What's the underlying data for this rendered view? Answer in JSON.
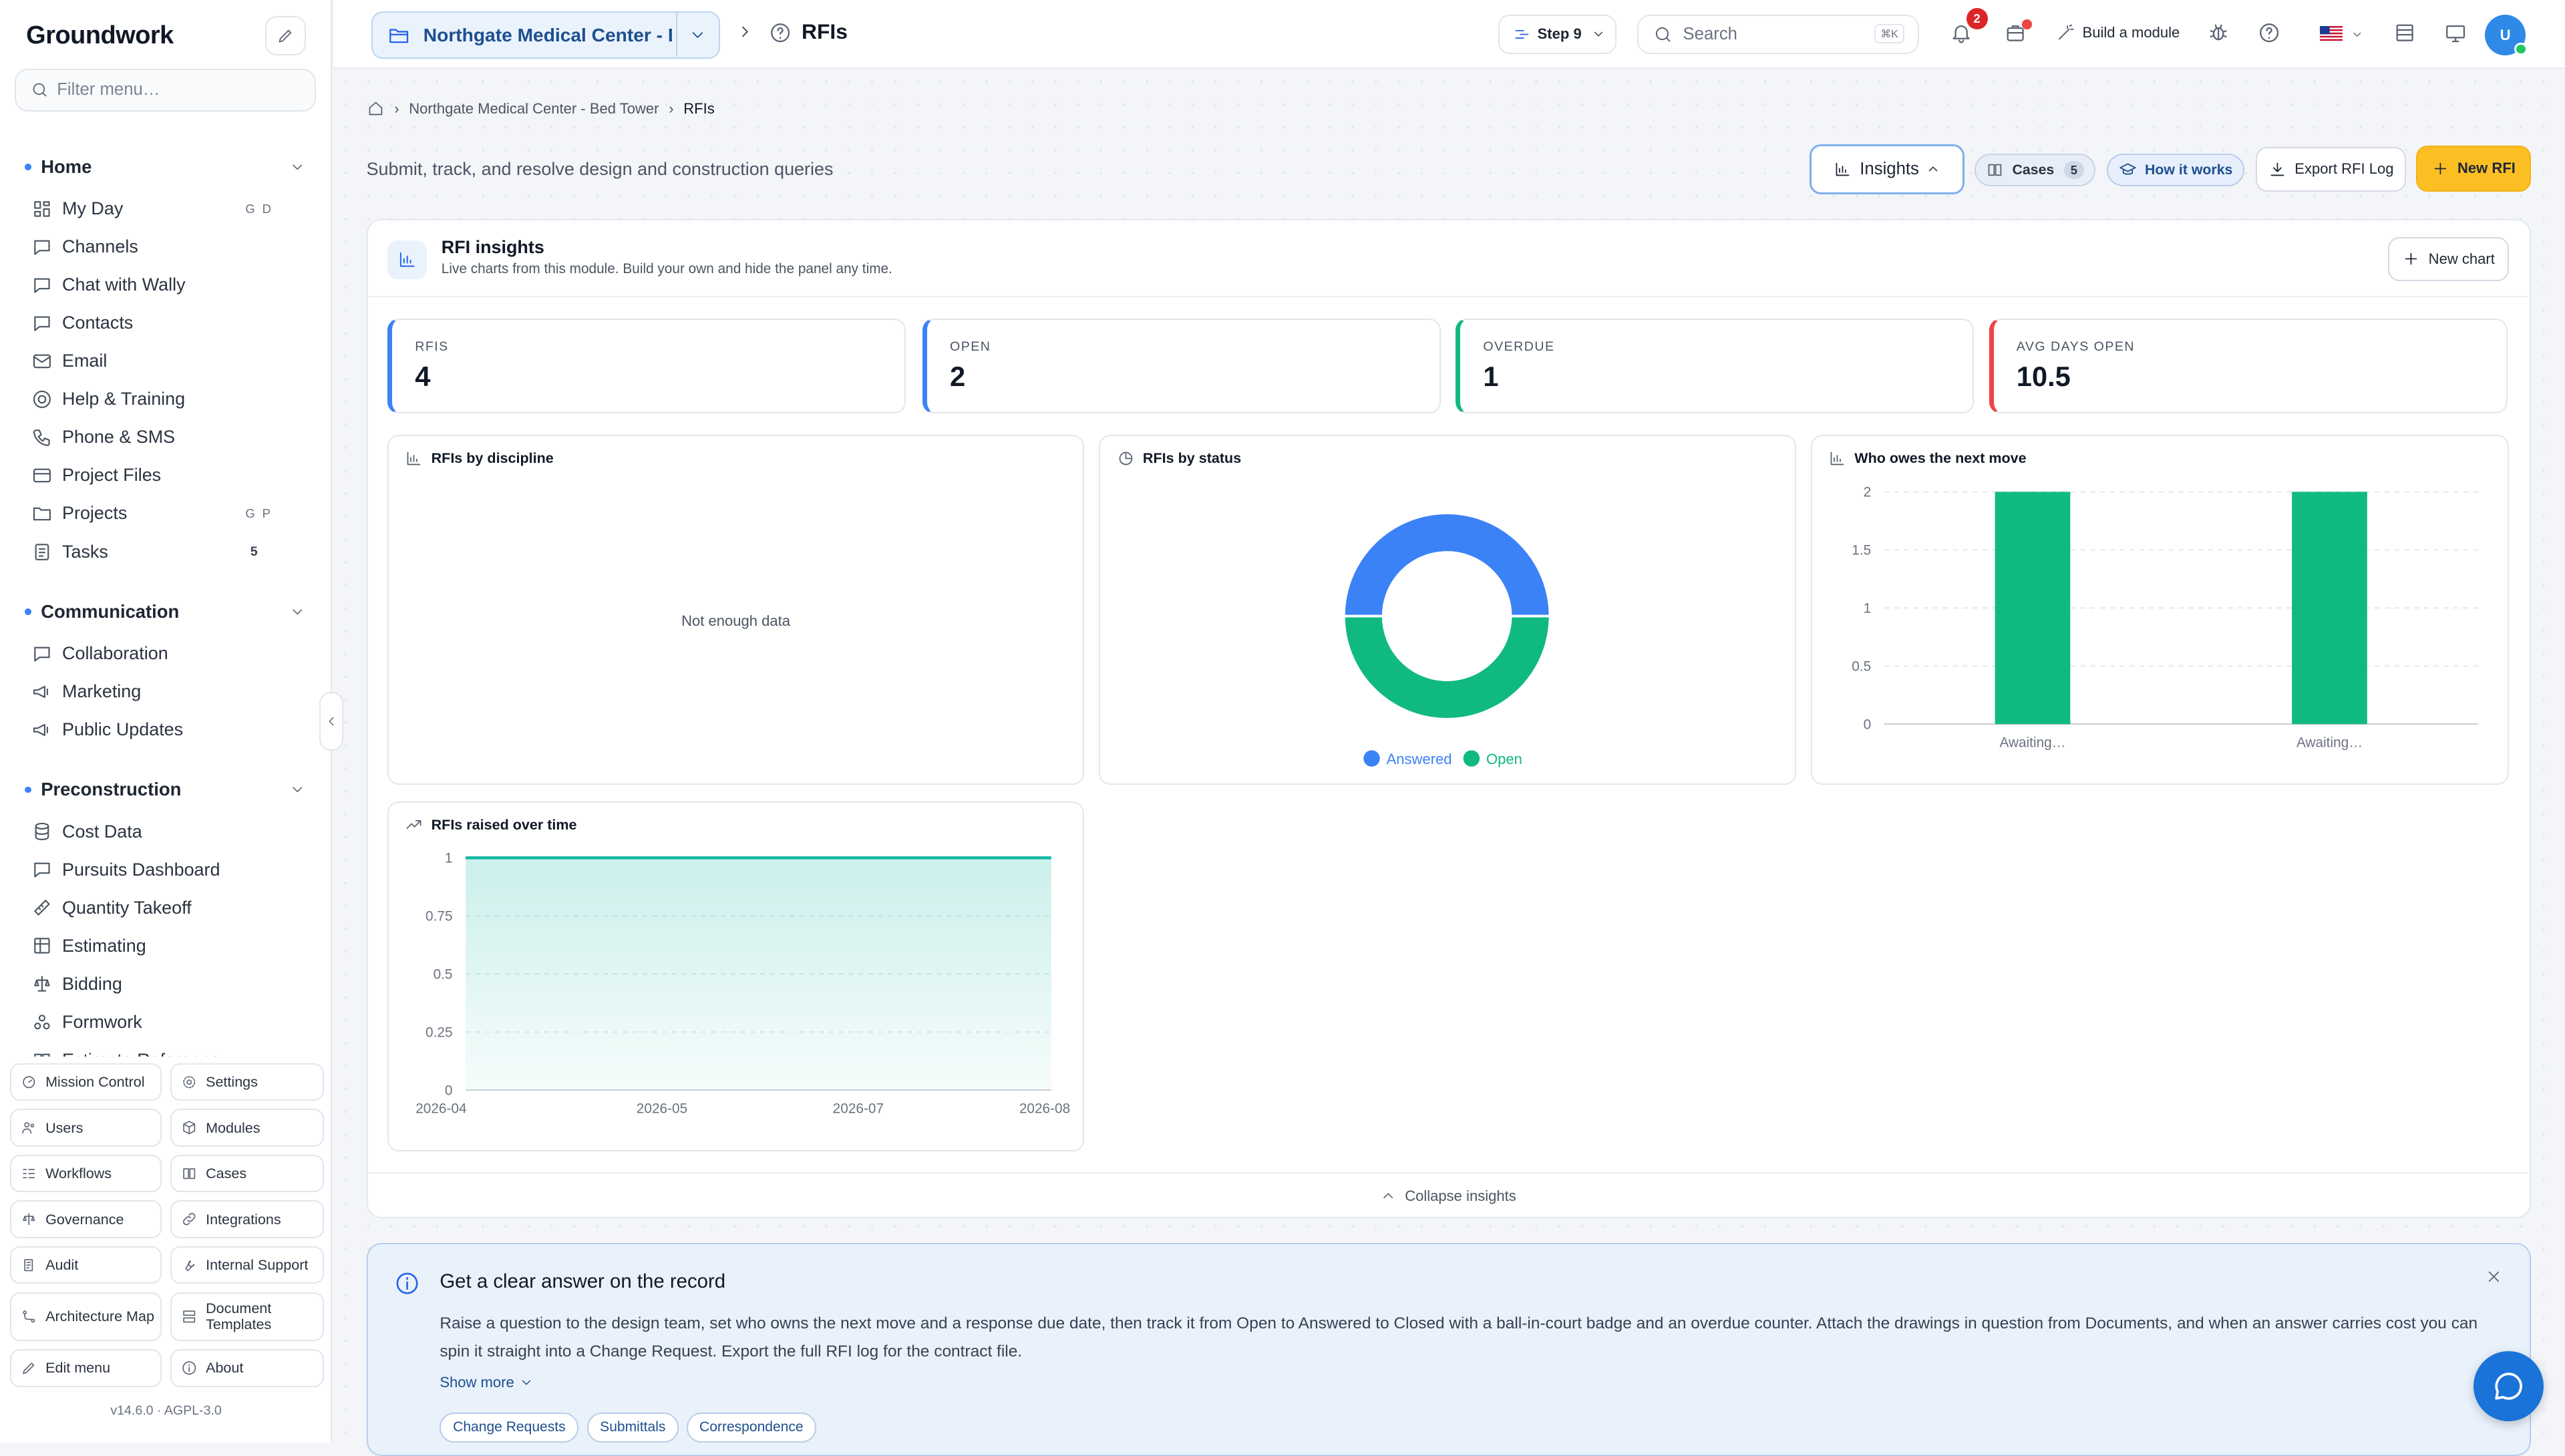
{
  "sidebar": {
    "brand": "Groundwork",
    "filter_placeholder": "Filter menu…",
    "sections": [
      {
        "label": "Home",
        "items": [
          {
            "label": "My Day",
            "icon": "grid-icon",
            "kbd": "G D"
          },
          {
            "label": "Channels",
            "icon": "chat-bubble-icon"
          },
          {
            "label": "Chat with Wally",
            "icon": "chat-bubble-icon"
          },
          {
            "label": "Contacts",
            "icon": "chat-bubble-icon"
          },
          {
            "label": "Email",
            "icon": "mail-icon"
          },
          {
            "label": "Help & Training",
            "icon": "lifebuoy-icon"
          },
          {
            "label": "Phone & SMS",
            "icon": "phone-icon"
          },
          {
            "label": "Project Files",
            "icon": "archive-icon"
          },
          {
            "label": "Projects",
            "icon": "folder-icon",
            "kbd": "G P"
          },
          {
            "label": "Tasks",
            "icon": "clipboard-icon",
            "count": "5"
          }
        ]
      },
      {
        "label": "Communication",
        "items": [
          {
            "label": "Collaboration",
            "icon": "chat-bubble-icon"
          },
          {
            "label": "Marketing",
            "icon": "megaphone-icon"
          },
          {
            "label": "Public Updates",
            "icon": "megaphone-icon"
          }
        ]
      },
      {
        "label": "Preconstruction",
        "items": [
          {
            "label": "Cost Data",
            "icon": "database-icon"
          },
          {
            "label": "Pursuits Dashboard",
            "icon": "chat-bubble-icon"
          },
          {
            "label": "Quantity Takeoff",
            "icon": "ruler-icon"
          },
          {
            "label": "Estimating",
            "icon": "table-icon"
          },
          {
            "label": "Bidding",
            "icon": "scale-icon"
          },
          {
            "label": "Formwork",
            "icon": "boxes-icon"
          },
          {
            "label": "Estimate Reference",
            "icon": "book-icon"
          }
        ]
      }
    ],
    "tools": [
      {
        "label": "Mission Control",
        "icon": "gauge-icon"
      },
      {
        "label": "Settings",
        "icon": "gear-icon"
      },
      {
        "label": "Users",
        "icon": "users-icon"
      },
      {
        "label": "Modules",
        "icon": "cube-icon"
      },
      {
        "label": "Workflows",
        "icon": "workflow-icon"
      },
      {
        "label": "Cases",
        "icon": "book-icon"
      },
      {
        "label": "Governance",
        "icon": "scale-icon"
      },
      {
        "label": "Integrations",
        "icon": "link-icon"
      },
      {
        "label": "Audit",
        "icon": "scroll-icon"
      },
      {
        "label": "Internal Support",
        "icon": "wrench-icon"
      },
      {
        "label": "Architecture Map",
        "icon": "map-icon"
      },
      {
        "label": "Document Templates",
        "icon": "template-icon"
      },
      {
        "label": "Edit menu",
        "icon": "pencil-icon"
      },
      {
        "label": "About",
        "icon": "info-icon"
      }
    ],
    "version": "v14.6.0  ·  AGPL-3.0"
  },
  "topbar": {
    "project_name": "Northgate Medical Center - B…",
    "page_title": "RFIs",
    "step_label": "Step 9",
    "search_placeholder": "Search",
    "search_shortcut": "⌘K",
    "notification_count": "2",
    "build_label": "Build a module",
    "avatar_initial": "U"
  },
  "breadcrumb": {
    "project": "Northgate Medical Center - Bed Tower",
    "current": "RFIs"
  },
  "header": {
    "subtitle": "Submit, track, and resolve design and construction queries",
    "insights_label": "Insights",
    "cases_label": "Cases",
    "cases_count": "5",
    "how_label": "How it works",
    "export_label": "Export RFI Log",
    "new_label": "New RFI"
  },
  "insights": {
    "title": "RFI insights",
    "subtitle": "Live charts from this module. Build your own and hide the panel any time.",
    "new_chart_label": "New chart",
    "collapse_label": "Collapse insights",
    "kpis": [
      {
        "label": "RFIS",
        "value": "4",
        "color": "#3b82f6"
      },
      {
        "label": "OPEN",
        "value": "2",
        "color": "#3b82f6"
      },
      {
        "label": "OVERDUE",
        "value": "1",
        "color": "#10b981"
      },
      {
        "label": "AVG DAYS OPEN",
        "value": "10.5",
        "color": "#ef4444"
      }
    ],
    "cards": {
      "discipline_title": "RFIs by discipline",
      "discipline_empty": "Not enough data",
      "status_title": "RFIs by status",
      "owes_title": "Who owes the next move",
      "over_time_title": "RFIs raised over time"
    }
  },
  "chart_data": [
    {
      "type": "pie",
      "title": "RFIs by status",
      "categories": [
        "Answered",
        "Open"
      ],
      "values": [
        2,
        2
      ],
      "colors": [
        "#3b82f6",
        "#10b981"
      ],
      "legend": "bottom"
    },
    {
      "type": "bar",
      "title": "Who owes the next move",
      "categories": [
        "Awaiting…",
        "Awaiting…"
      ],
      "values": [
        2,
        2
      ],
      "ylim": [
        0,
        2
      ],
      "yticks": [
        0,
        0.5,
        1,
        1.5,
        2
      ],
      "color": "#10b981",
      "grid": true
    },
    {
      "type": "area",
      "title": "RFIs raised over time",
      "x": [
        "2026-04",
        "2026-08"
      ],
      "values": [
        1,
        1
      ],
      "xticks": [
        "2026-04",
        "2026-05",
        "2026-07",
        "2026-08"
      ],
      "ylim": [
        0,
        1
      ],
      "yticks": [
        0,
        0.25,
        0.5,
        0.75,
        1
      ],
      "color": "#14b8a6",
      "grid": true
    }
  ],
  "info": {
    "title": "Get a clear answer on the record",
    "body": "Raise a question to the design team, set who owns the next move and a response due date, then track it from Open to Answered to Closed with a ball-in-court badge and an overdue counter. Attach the drawings in question from Documents, and when an answer carries cost you can spin it straight into a Change Request. Export the full RFI log for the contract file.",
    "show_more": "Show more",
    "chips": [
      "Change Requests",
      "Submittals",
      "Correspondence"
    ]
  }
}
